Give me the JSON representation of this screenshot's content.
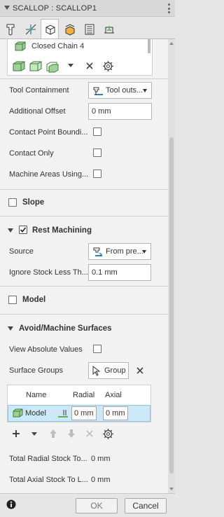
{
  "window": {
    "title": "SCALLOP : SCALLOP1"
  },
  "tabs": [
    {
      "icon": "tool-tab-icon",
      "active": false
    },
    {
      "icon": "geometry-tab-icon",
      "active": false
    },
    {
      "icon": "heights-tab-icon",
      "active": true
    },
    {
      "icon": "passes-tab-icon",
      "active": false
    },
    {
      "icon": "linking-tab-icon",
      "active": false
    },
    {
      "icon": "post-tab-icon",
      "active": false
    }
  ],
  "machining_boundary": {
    "selection": "Closed Chain 4"
  },
  "fields": {
    "tool_containment_label": "Tool Containment",
    "tool_containment_value": "Tool outs...",
    "additional_offset_label": "Additional Offset",
    "additional_offset_value": "0 mm",
    "contact_point_label": "Contact Point Boundi...",
    "contact_only_label": "Contact Only",
    "machine_areas_label": "Machine Areas Using..."
  },
  "sections": {
    "slope": "Slope",
    "rest_machining": "Rest Machining",
    "model": "Model",
    "avoid_machine_surfaces": "Avoid/Machine Surfaces"
  },
  "rest": {
    "source_label": "Source",
    "source_value": "From pre...",
    "ignore_stock_label": "Ignore Stock Less Th...",
    "ignore_stock_value": "0.1 mm"
  },
  "avoid": {
    "view_absolute_label": "View Absolute Values",
    "surface_groups_label": "Surface Groups",
    "group_button": "Group",
    "table_headers": {
      "name": "Name",
      "radial": "Radial",
      "axial": "Axial"
    },
    "rows": [
      {
        "name": "Model",
        "radial": "0 mm",
        "axial": "0 mm"
      }
    ],
    "total_radial_label": "Total Radial Stock To...",
    "total_radial_value": "0 mm",
    "total_axial_label": "Total Axial Stock To L...",
    "total_axial_value": "0 mm"
  },
  "footer": {
    "ok": "OK",
    "cancel": "Cancel"
  },
  "colors": {
    "accent_selection": "#cde8f7",
    "icon_green": "#5fae57",
    "icon_blue": "#2f7fc1"
  }
}
